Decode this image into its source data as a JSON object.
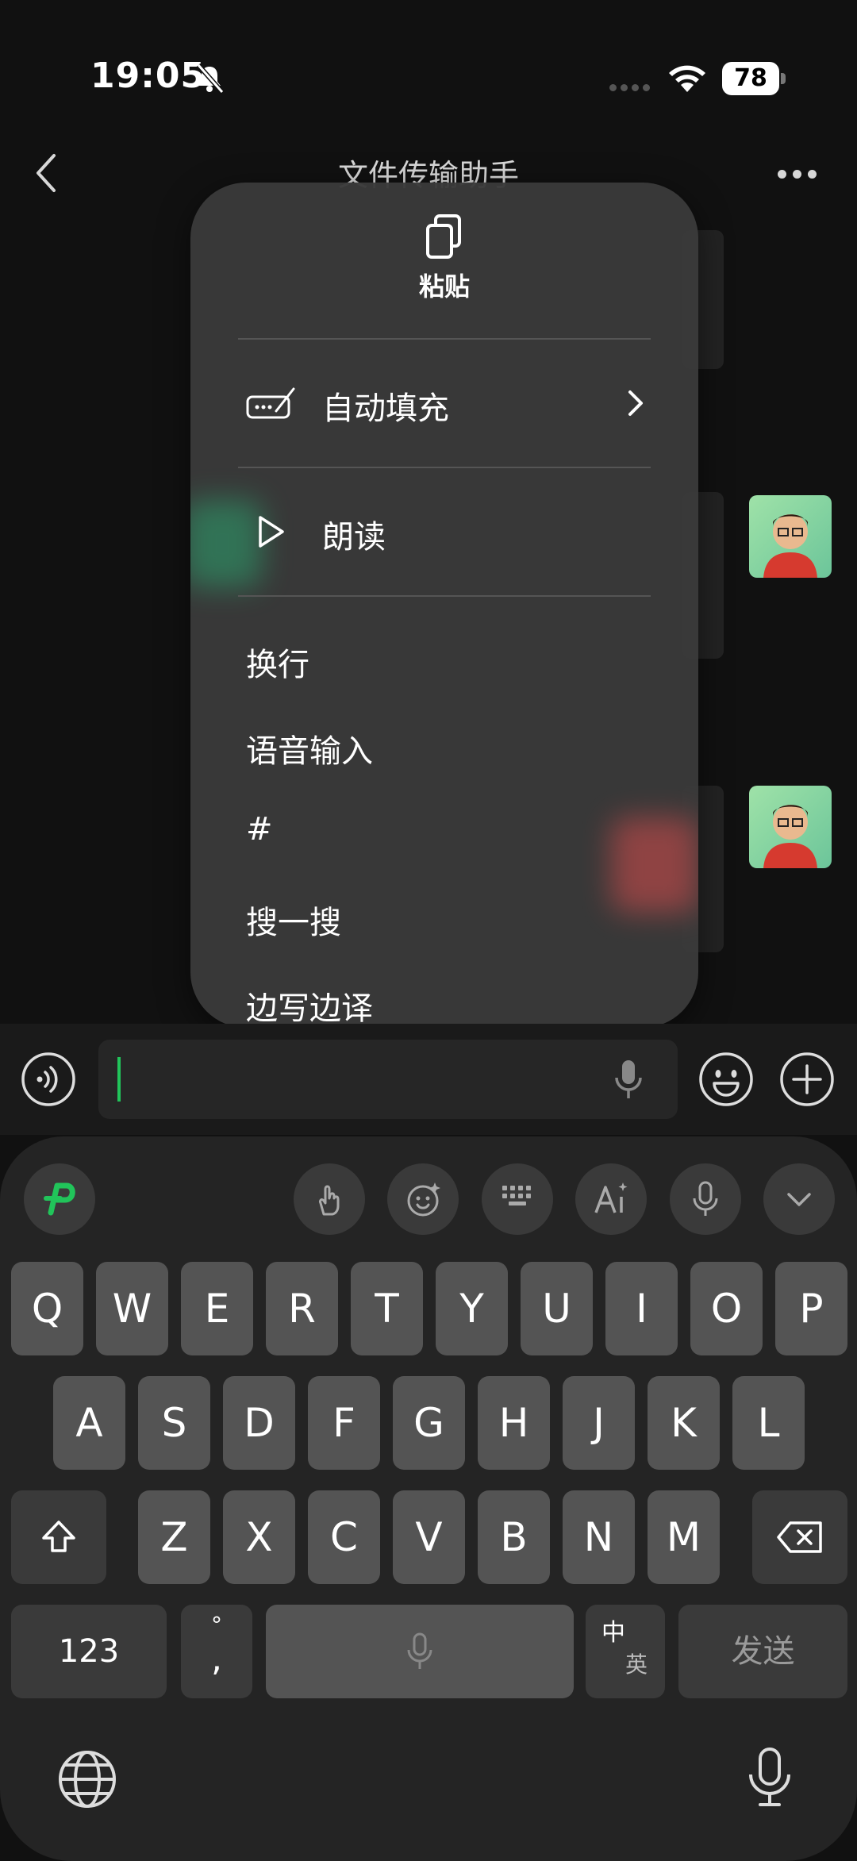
{
  "status": {
    "time": "19:05",
    "battery": "78"
  },
  "nav": {
    "title": "文件传输助手"
  },
  "menu": {
    "paste_label": "粘贴",
    "autofill_label": "自动填充",
    "read_label": "朗读",
    "items": [
      "换行",
      "语音输入",
      "#",
      "搜一搜",
      "边写边译"
    ]
  },
  "input": {
    "value": ""
  },
  "keyboard": {
    "row1": [
      "Q",
      "W",
      "E",
      "R",
      "T",
      "Y",
      "U",
      "I",
      "O",
      "P"
    ],
    "row2": [
      "A",
      "S",
      "D",
      "F",
      "G",
      "H",
      "J",
      "K",
      "L"
    ],
    "row3": [
      "Z",
      "X",
      "C",
      "V",
      "B",
      "N",
      "M"
    ],
    "numbers_label": "123",
    "punct_top": "°",
    "punct_bottom": ",",
    "lang_top": "中",
    "lang_bottom": "英",
    "send_label": "发送"
  },
  "colors": {
    "cursor": "#21c45a",
    "brand": "#21c45a"
  }
}
